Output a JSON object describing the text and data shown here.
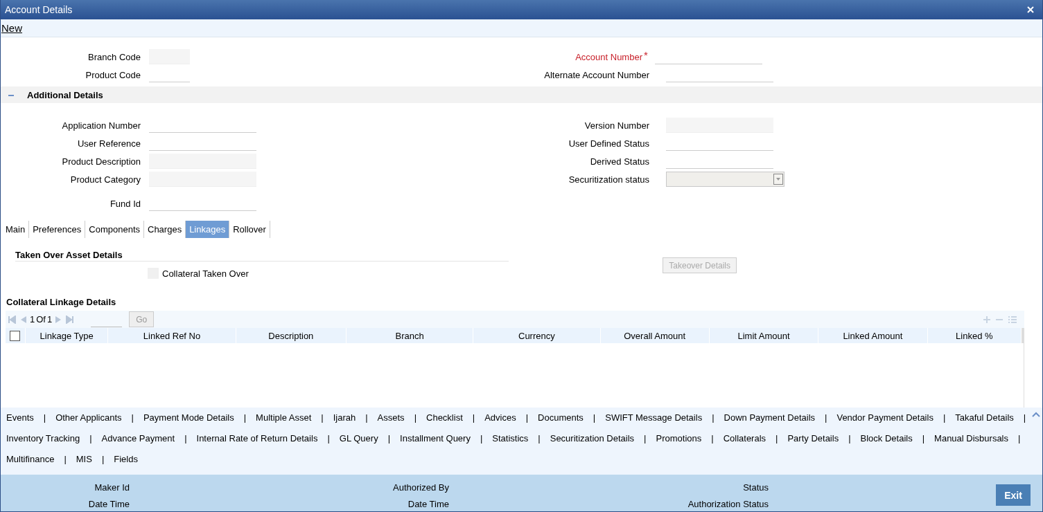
{
  "window": {
    "title": "Account Details"
  },
  "toolbar": {
    "link": "New"
  },
  "header_fields": {
    "left": [
      {
        "label": "Branch Code",
        "disabled": true,
        "required": false
      },
      {
        "label": "Product Code",
        "disabled": false,
        "required": false
      }
    ],
    "right": [
      {
        "label": "Account Number",
        "disabled": false,
        "required": true,
        "mark": "*"
      },
      {
        "label": "Alternate Account Number",
        "disabled": false,
        "required": false
      }
    ]
  },
  "section": {
    "title": "Additional Details",
    "expanded": true,
    "left": [
      {
        "label": "Application Number",
        "disabled": false
      },
      {
        "label": "User Reference",
        "disabled": false
      },
      {
        "label": "Product Description",
        "disabled": true
      },
      {
        "label": "Product Category",
        "disabled": true
      },
      {
        "label": "Fund Id",
        "disabled": false
      }
    ],
    "right": [
      {
        "label": "Version Number",
        "kind": "text",
        "disabled": true
      },
      {
        "label": "User Defined Status",
        "kind": "text",
        "disabled": false
      },
      {
        "label": "Derived Status",
        "kind": "text",
        "disabled": false
      },
      {
        "label": "Securitization status",
        "kind": "select",
        "disabled": true
      }
    ]
  },
  "tabs": [
    {
      "label": "Main",
      "selected": false
    },
    {
      "label": "Preferences",
      "selected": false
    },
    {
      "label": "Components",
      "selected": false
    },
    {
      "label": "Charges",
      "selected": false
    },
    {
      "label": "Linkages",
      "selected": true
    },
    {
      "label": "Rollover",
      "selected": false
    }
  ],
  "taken_over": {
    "title": "Taken Over Asset Details",
    "checkbox": {
      "label": "Collateral Taken Over",
      "checked": false,
      "disabled": true
    },
    "button": {
      "label": "Takeover Details",
      "disabled": true
    }
  },
  "collateral": {
    "title": "Collateral Linkage Details",
    "pager": {
      "page": "1",
      "of": "Of",
      "total": "1",
      "go": "Go"
    },
    "select_all_checked": false,
    "columns": [
      "Linkage Type",
      "Linked Ref No",
      "Description",
      "Branch",
      "Currency",
      "Overall Amount",
      "Limit Amount",
      "Linked Amount",
      "Linked %"
    ]
  },
  "links": {
    "separator": "|",
    "lines": [
      [
        "Events",
        "Other Applicants",
        "Payment Mode Details",
        "Multiple Asset",
        "Ijarah",
        "Assets",
        "Checklist",
        "Advices",
        "Documents",
        "SWIFT Message Details",
        "Down Payment Details",
        "Vendor Payment Details",
        "Takaful Details"
      ],
      [
        "Inventory Tracking",
        "Advance Payment",
        "Internal Rate of Return Details",
        "GL Query",
        "Installment Query",
        "Statistics",
        "Securitization Details",
        "Promotions",
        "Collaterals",
        "Party Details",
        "Block Details",
        "Manual Disbursals"
      ],
      [
        "Multifinance",
        "MIS",
        "Fields"
      ]
    ]
  },
  "footer": {
    "columns": [
      [
        "Maker Id",
        "Date Time"
      ],
      [
        "Authorized By",
        "Date Time"
      ],
      [
        "Status",
        "Authorization Status"
      ]
    ],
    "exit": "Exit"
  }
}
